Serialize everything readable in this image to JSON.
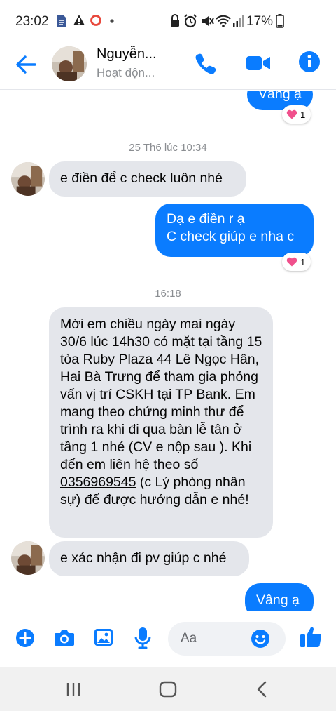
{
  "status_bar": {
    "time": "23:02",
    "battery": "17%",
    "icons": [
      "document-icon",
      "warning-icon",
      "record-ring-icon",
      "dot-icon",
      "lock-icon",
      "alarm-icon",
      "mute-icon",
      "wifi-icon",
      "signal-icon",
      "battery-icon"
    ]
  },
  "header": {
    "name": "Nguyễn...",
    "status": "Hoạt độn...",
    "accent": "#0a7cff"
  },
  "messages": {
    "top_partial": {
      "text": "Vâng ạ",
      "reaction": "1"
    },
    "ts1": "25 Th6 lúc 10:34",
    "m1": {
      "text": "e điền để c check luôn nhé"
    },
    "m2": {
      "line1": "Dạ e điền r ạ",
      "line2": "C check giúp e nha c",
      "reaction": "1"
    },
    "ts2": "16:18",
    "m3": {
      "text_before": "Mời em  chiều ngày mai ngày 30/6 lúc 14h30 có mặt tại tầng 15 tòa Ruby Plaza 44 Lê Ngọc Hân, Hai Bà Trưng để tham gia phỏng vấn vị trí CSKH tại TP Bank. Em mang theo chứng minh thư để trình ra khi đi qua bàn lễ tân ở tầng 1 nhé (CV e nộp sau ). Khi đến em liên hệ theo số ",
      "phone": "0356969545",
      "text_after": " (c Lý phòng nhân sự) để được hướng dẫn e nhé!"
    },
    "m4": {
      "text": "e xác nhận đi pv giúp c nhé"
    },
    "m5": {
      "text": "Vâng ạ"
    }
  },
  "composer": {
    "placeholder": "Aa",
    "icons": [
      "plus-icon",
      "camera-icon",
      "gallery-icon",
      "microphone-icon",
      "emoji-icon",
      "like-icon"
    ]
  },
  "navbar": {
    "buttons": [
      "recents-icon",
      "home-icon",
      "back-nav-icon"
    ]
  }
}
